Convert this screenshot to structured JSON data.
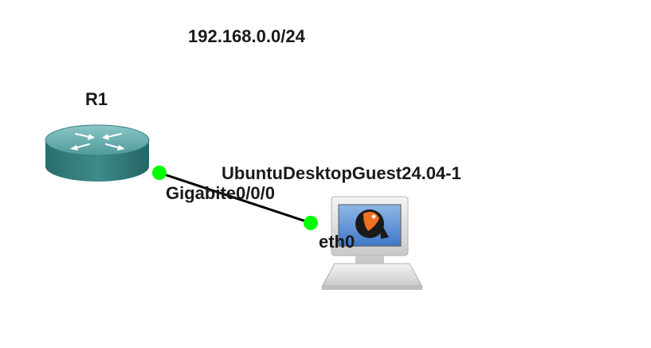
{
  "network": {
    "label": "192.168.0.0/24"
  },
  "nodes": {
    "router": {
      "name": "R1",
      "icon": "router-icon"
    },
    "host": {
      "name": "UbuntuDesktopGuest24.04-1",
      "icon": "computer-icon"
    }
  },
  "link": {
    "router_interface": "Gigabite0/0/0",
    "host_interface": "eth0",
    "status_color": "#00ff00"
  },
  "colors": {
    "router_top": "#5aa5a5",
    "router_side": "#2f7a7a",
    "link": "#000000"
  }
}
